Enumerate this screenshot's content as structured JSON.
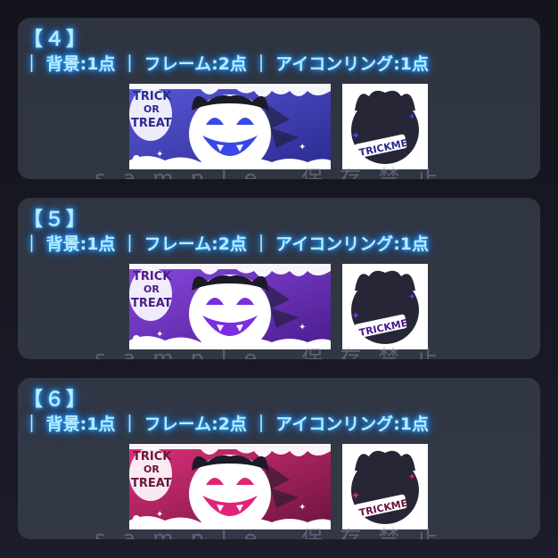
{
  "panels": [
    {
      "title": "【４】",
      "subtitle": "｜ 背景:1点 ｜ フレーム:2点 ｜ アイコンリング:1点",
      "accent": "#2a2a90",
      "accent_light": "#5a58d8",
      "face_color": "#3a48e8",
      "bubble_text_1": "TRICK",
      "bubble_text_2": "OR",
      "bubble_text_3": "TREAT",
      "icon_label": "TRICKME",
      "watermark": "sample_保存禁止"
    },
    {
      "title": "【５】",
      "subtitle": "｜ 背景:1点 ｜ フレーム:2点 ｜ アイコンリング:1点",
      "accent": "#4a1c8c",
      "accent_light": "#8a48e0",
      "face_color": "#7a2ee0",
      "bubble_text_1": "TRICK",
      "bubble_text_2": "OR",
      "bubble_text_3": "TREAT",
      "icon_label": "TRICKME",
      "watermark": "sample_保存禁止"
    },
    {
      "title": "【６】",
      "subtitle": "｜ 背景:1点 ｜ フレーム:2点 ｜ アイコンリング:1点",
      "accent": "#6a1440",
      "accent_light": "#e0307a",
      "face_color": "#e0247a",
      "bubble_text_1": "TRICK",
      "bubble_text_2": "OR",
      "bubble_text_3": "TREAT",
      "icon_label": "TRICKME",
      "watermark": "sample_保存禁止"
    }
  ]
}
